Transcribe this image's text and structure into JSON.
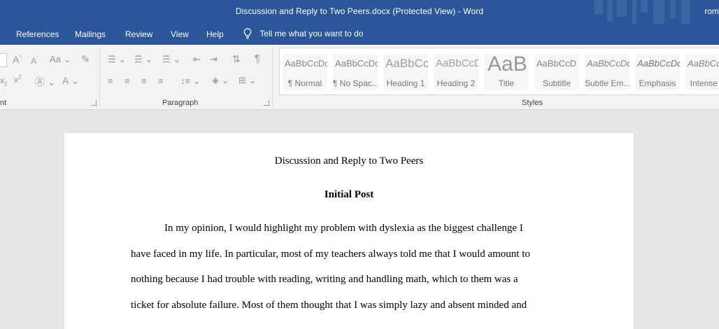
{
  "window": {
    "title": "Discussion and Reply to Two Peers.docx (Protected View)  -  Word",
    "user": "rom"
  },
  "tabs": [
    "References",
    "Mailings",
    "Review",
    "View",
    "Help"
  ],
  "tell_me": "Tell me what you want to do",
  "ribbon": {
    "font_group_label": "nt",
    "paragraph_group_label": "Paragraph",
    "styles_group_label": "Styles",
    "styles": [
      {
        "preview": "AaBbCcDc",
        "label": "¶ Normal"
      },
      {
        "preview": "AaBbCcDc",
        "label": "¶ No Spac..."
      },
      {
        "preview": "AaBbCc",
        "label": "Heading 1"
      },
      {
        "preview": "AaBbCcD",
        "label": "Heading 2"
      },
      {
        "preview": "AaB",
        "label": "Title"
      },
      {
        "preview": "AaBbCcD",
        "label": "Subtitle"
      },
      {
        "preview": "AaBbCcDc",
        "label": "Subtle Em..."
      },
      {
        "preview": "AaBbCcDc",
        "label": "Emphasis"
      },
      {
        "preview": "AaBbCcDc",
        "label": "Intense E"
      }
    ]
  },
  "document": {
    "title": "Discussion and Reply to Two Peers",
    "heading": "Initial Post",
    "lines": [
      "In my opinion, I would highlight my problem with dyslexia as the biggest challenge I",
      "have faced in my life. In particular, most of my teachers always told me that I would amount to",
      "nothing because I had trouble with reading, writing and handling math, which to them was a",
      "ticket for absolute failure. Most of them thought that I was simply lazy and absent minded and"
    ]
  },
  "colors": {
    "titlebar": "#2b579a",
    "ribbon": "#f3f3f3",
    "canvas": "#e6e6e6",
    "page": "#ffffff"
  }
}
